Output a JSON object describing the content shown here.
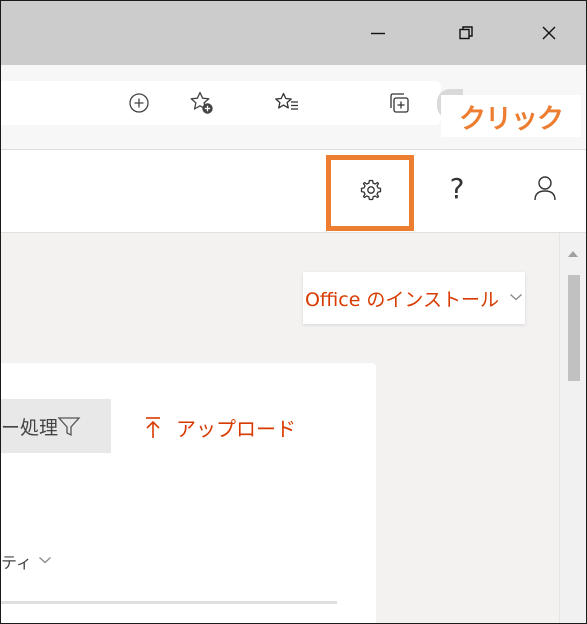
{
  "window": {
    "controls": {
      "minimize": "minimize-icon",
      "restore": "restore-icon",
      "close": "close-icon"
    }
  },
  "browser_toolbar": {
    "icons": [
      "add-tab-icon",
      "add-favorite-icon",
      "favorites-list-icon",
      "collections-icon"
    ]
  },
  "callout": {
    "label": "クリック",
    "color": "#ed7d31"
  },
  "app_header": {
    "help_label": "?",
    "icons": [
      "settings-gear-icon",
      "help-icon",
      "account-person-icon"
    ]
  },
  "content": {
    "office_install_label": "Office のインストール",
    "batch_label": "ー処理",
    "upload_label": "アップロード",
    "property_label": "ティ",
    "accent": "#d83b01"
  }
}
